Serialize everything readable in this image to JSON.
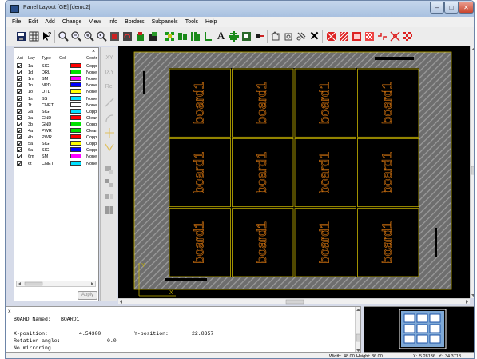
{
  "window": {
    "title": "Panel Layout [GE] [demo2]",
    "minimize": "–",
    "maximize": "□",
    "close": "✕"
  },
  "menu": [
    "File",
    "Edit",
    "Add",
    "Change",
    "View",
    "Info",
    "Borders",
    "Subpanels",
    "Tools",
    "Help"
  ],
  "toolbar": {
    "icons": [
      "save-icon",
      "grid-icon",
      "help-pointer-icon",
      "zoom-icon",
      "zoom-out-icon",
      "zoom-in-icon",
      "zoom-previous-icon",
      "zoom-window-icon",
      "refresh-icon",
      "panel-icon",
      "board-icon",
      "add-pads-icon",
      "add-parts-icon",
      "multi-pads-icon",
      "line-icon",
      "text-icon",
      "fiducial-icon",
      "component-icon",
      "drill-icon",
      "undo-icon",
      "redo-icon",
      "copy-icon",
      "delete-icon",
      "routing-icon",
      "hatch-icon",
      "fill-icon",
      "pattern-icon",
      "breakaway-icon",
      "mousebite-icon"
    ]
  },
  "layers": {
    "headers": {
      "act": "Act",
      "lay": "Lay",
      "type": "Type",
      "col": "Col",
      "contr": "Contr"
    },
    "rows": [
      {
        "lay": "1a",
        "type": "SIG",
        "color": "#ff0000",
        "contr": "Copp"
      },
      {
        "lay": "1d",
        "type": "DRL",
        "color": "#00e000",
        "contr": "None"
      },
      {
        "lay": "1m",
        "type": "SM",
        "color": "#ff00ff",
        "contr": "None"
      },
      {
        "lay": "1n",
        "type": "NPD",
        "color": "#0000ff",
        "contr": "None"
      },
      {
        "lay": "1o",
        "type": "OTL",
        "color": "#ffff00",
        "contr": "None"
      },
      {
        "lay": "1s",
        "type": "SS",
        "color": "#00e0ff",
        "contr": "None"
      },
      {
        "lay": "1t",
        "type": "CNET",
        "color": "#ffffff",
        "contr": "None"
      },
      {
        "lay": "2a",
        "type": "SIG",
        "color": "#00e0ff",
        "contr": "Copp"
      },
      {
        "lay": "3a",
        "type": "GND",
        "color": "#ff0000",
        "contr": "Clear"
      },
      {
        "lay": "3b",
        "type": "GND",
        "color": "#00e000",
        "contr": "Copp"
      },
      {
        "lay": "4a",
        "type": "PWR",
        "color": "#00e000",
        "contr": "Clear"
      },
      {
        "lay": "4b",
        "type": "PWR",
        "color": "#ff0000",
        "contr": "Copp"
      },
      {
        "lay": "5a",
        "type": "SIG",
        "color": "#ffff00",
        "contr": "Copp"
      },
      {
        "lay": "6a",
        "type": "SIG",
        "color": "#0000ff",
        "contr": "Copp"
      },
      {
        "lay": "6m",
        "type": "SM",
        "color": "#ff00ff",
        "contr": "None"
      },
      {
        "lay": "6t",
        "type": "CNET",
        "color": "#00e0ff",
        "contr": "None"
      }
    ],
    "checkmark": "✔",
    "apply": "Apply"
  },
  "vtools": [
    "XY",
    "IXY",
    "Rel"
  ],
  "canvas": {
    "board_label": "board1",
    "grid_rows": 3,
    "grid_cols": 4,
    "axis_x": "X",
    "axis_y": "Y",
    "colors": {
      "background": "#000000",
      "hatch": "#8a8a8a",
      "outline": "#c8b400",
      "board_text": "#e07a10"
    }
  },
  "info": {
    "close": "x",
    "board_named_label": "BOARD Named:",
    "board_named_value": "BOARD1",
    "x_position_label": "X-position:",
    "x_position_value": "4.54300",
    "y_position_label": "Y-position:",
    "y_position_value": "22.8357",
    "rotation_label": "Rotation angle:",
    "rotation_value": "0.0",
    "mirroring": "No mirroring."
  },
  "status": {
    "width_label": "Width:",
    "width_value": "48.00",
    "height_label": "Height:",
    "height_value": "36.00",
    "x_label": "X:",
    "x_value": "5.28136",
    "y_label": "Y:",
    "y_value": "34.3718"
  }
}
